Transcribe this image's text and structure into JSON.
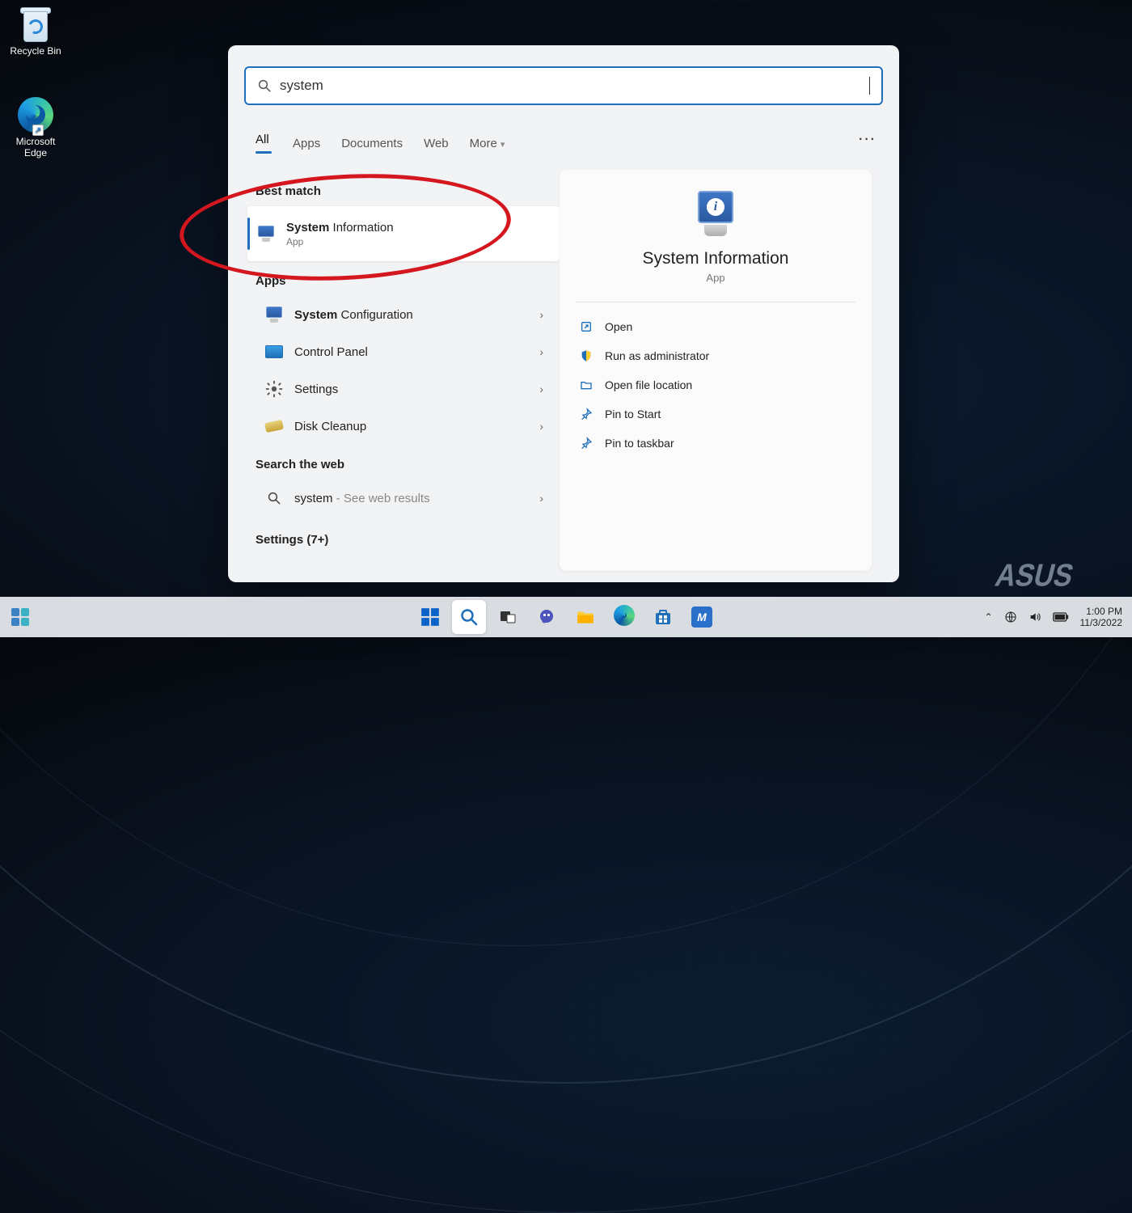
{
  "desktop": {
    "recycle_bin": "Recycle Bin",
    "edge": "Microsoft Edge"
  },
  "brand": "ASUS",
  "search": {
    "query": "system",
    "filters": {
      "all": "All",
      "apps": "Apps",
      "documents": "Documents",
      "web": "Web",
      "more": "More"
    },
    "sections": {
      "best_match": "Best match",
      "apps": "Apps",
      "search_web": "Search the web",
      "settings_more": "Settings (7+)"
    },
    "best": {
      "title_bold": "System",
      "title_rest": " Information",
      "subtitle": "App"
    },
    "apps_list": [
      {
        "bold": "System",
        "rest": " Configuration"
      },
      {
        "bold": "",
        "rest": "Control Panel"
      },
      {
        "bold": "",
        "rest": "Settings"
      },
      {
        "bold": "",
        "rest": "Disk Cleanup"
      }
    ],
    "web_row": {
      "term": "system",
      "hint": " - See web results"
    }
  },
  "preview": {
    "title": "System Information",
    "subtitle": "App",
    "actions": {
      "open": "Open",
      "run_admin": "Run as administrator",
      "open_loc": "Open file location",
      "pin_start": "Pin to Start",
      "pin_taskbar": "Pin to taskbar"
    }
  },
  "taskbar": {
    "time": "1:00 PM",
    "date": "11/3/2022"
  }
}
